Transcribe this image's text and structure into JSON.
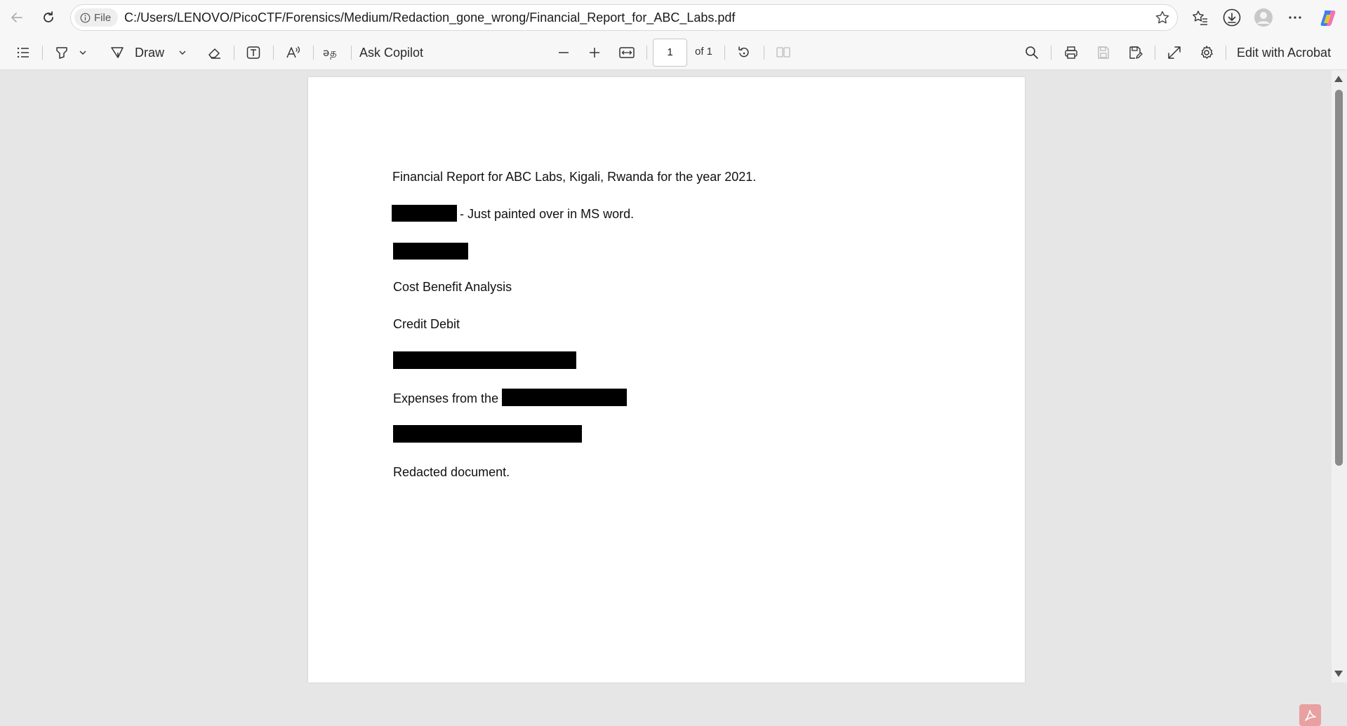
{
  "browser": {
    "file_chip_label": "File",
    "url": "C:/Users/LENOVO/PicoCTF/Forensics/Medium/Redaction_gone_wrong/Financial_Report_for_ABC_Labs.pdf"
  },
  "toolbar": {
    "draw_label": "Draw",
    "ask_copilot_label": "Ask Copilot",
    "page_number": "1",
    "page_of": "of 1",
    "edit_acrobat_label": "Edit with Acrobat"
  },
  "document": {
    "line1": "Financial Report for ABC Labs, Kigali, Rwanda for the year 2021.",
    "line2_suffix": "- Just painted over in MS word.",
    "line4": "Cost Benefit Analysis",
    "line5": "Credit Debit",
    "line7_prefix": "Expenses from the",
    "line9": "Redacted document."
  },
  "colors": {
    "redaction": "#000000",
    "acrobat_badge": "#e8a0a0"
  }
}
